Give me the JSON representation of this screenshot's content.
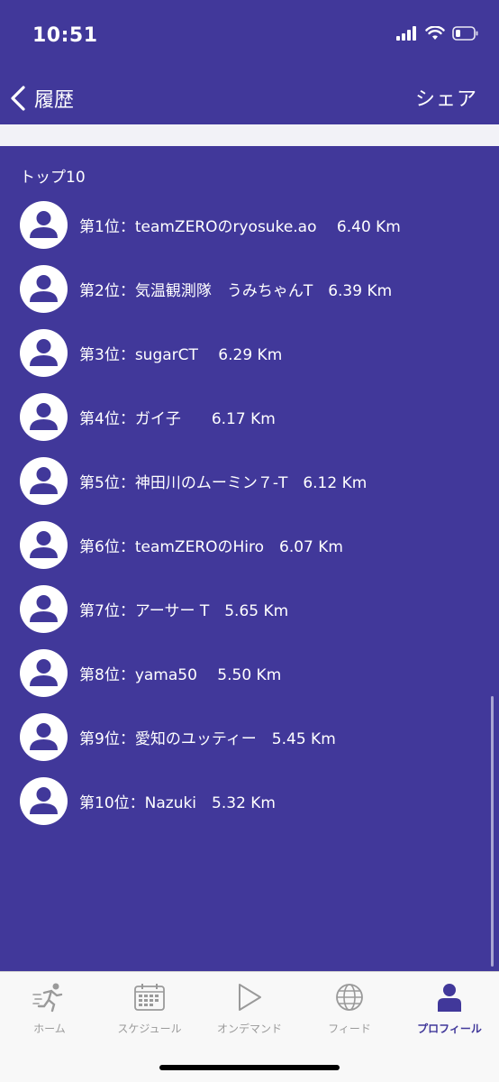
{
  "status_bar": {
    "time": "10:51"
  },
  "nav": {
    "title": "履歴",
    "share_label": "シェア"
  },
  "section_title": "トップ10",
  "ranking": [
    {
      "label": "第1位：teamZEROのryosuke.ao　 6.40 Km"
    },
    {
      "label": "第2位：気温観測隊　うみちゃんT　6.39 Km"
    },
    {
      "label": "第3位：sugarCT　 6.29 Km"
    },
    {
      "label": "第4位：ガイ子　　6.17 Km"
    },
    {
      "label": "第5位：神田川のムーミン７-T　6.12 Km"
    },
    {
      "label": "第6位：teamZEROのHiro　6.07 Km"
    },
    {
      "label": "第7位：アーサー T　5.65 Km"
    },
    {
      "label": "第8位：yama50　 5.50 Km"
    },
    {
      "label": "第9位：愛知のユッティー　5.45 Km"
    },
    {
      "label": "第10位：Nazuki　5.32 Km"
    }
  ],
  "tabs": [
    {
      "label": "ホーム",
      "icon": "runner-icon"
    },
    {
      "label": "スケジュール",
      "icon": "calendar-icon"
    },
    {
      "label": "オンデマンド",
      "icon": "play-icon"
    },
    {
      "label": "フィード",
      "icon": "globe-icon"
    },
    {
      "label": "プロフィール",
      "icon": "person-icon"
    }
  ],
  "active_tab": "プロフィール",
  "colors": {
    "primary": "#41389a",
    "tab_inactive": "#9a9a9a"
  }
}
